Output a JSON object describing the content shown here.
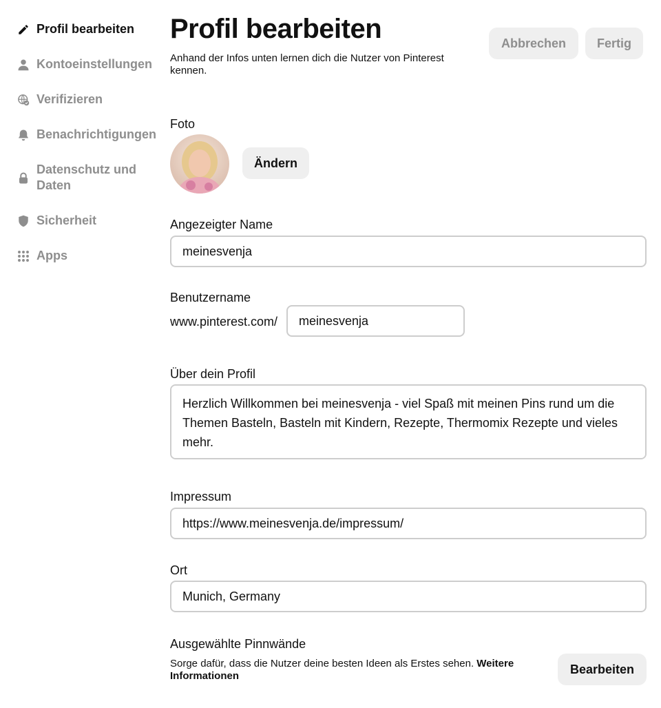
{
  "sidebar": {
    "items": [
      {
        "label": "Profil bearbeiten",
        "icon": "pencil-icon",
        "active": true
      },
      {
        "label": "Kontoeinstellungen",
        "icon": "person-icon",
        "active": false
      },
      {
        "label": "Verifizieren",
        "icon": "globe-check-icon",
        "active": false
      },
      {
        "label": "Benachrichtigungen",
        "icon": "bell-icon",
        "active": false
      },
      {
        "label": "Datenschutz und Daten",
        "icon": "lock-icon",
        "active": false
      },
      {
        "label": "Sicherheit",
        "icon": "shield-icon",
        "active": false
      },
      {
        "label": "Apps",
        "icon": "apps-grid-icon",
        "active": false
      }
    ]
  },
  "header": {
    "title": "Profil bearbeiten",
    "subtitle": "Anhand der Infos unten lernen dich die Nutzer von Pinterest kennen.",
    "cancel_label": "Abbrechen",
    "done_label": "Fertig"
  },
  "photo": {
    "label": "Foto",
    "change_label": "Ändern"
  },
  "display_name": {
    "label": "Angezeigter Name",
    "value": "meinesvenja"
  },
  "username": {
    "label": "Benutzername",
    "prefix": "www.pinterest.com/",
    "value": "meinesvenja"
  },
  "about": {
    "label": "Über dein Profil",
    "value": "Herzlich Willkommen bei meinesvenja - viel Spaß mit meinen Pins rund um die Themen Basteln, Basteln mit Kindern, Rezepte, Thermomix Rezepte und vieles mehr."
  },
  "imprint": {
    "label": "Impressum",
    "value": "https://www.meinesvenja.de/impressum/"
  },
  "location": {
    "label": "Ort",
    "value": "Munich, Germany"
  },
  "featured_boards": {
    "label": "Ausgewählte Pinnwände",
    "help_text": "Sorge dafür, dass die Nutzer deine besten Ideen als Erstes sehen.",
    "learn_more": "Weitere Informationen",
    "edit_label": "Bearbeiten"
  },
  "colors": {
    "button_bg": "#efefef",
    "muted_text": "#8e8e8e",
    "input_border": "#cdcdcd"
  }
}
